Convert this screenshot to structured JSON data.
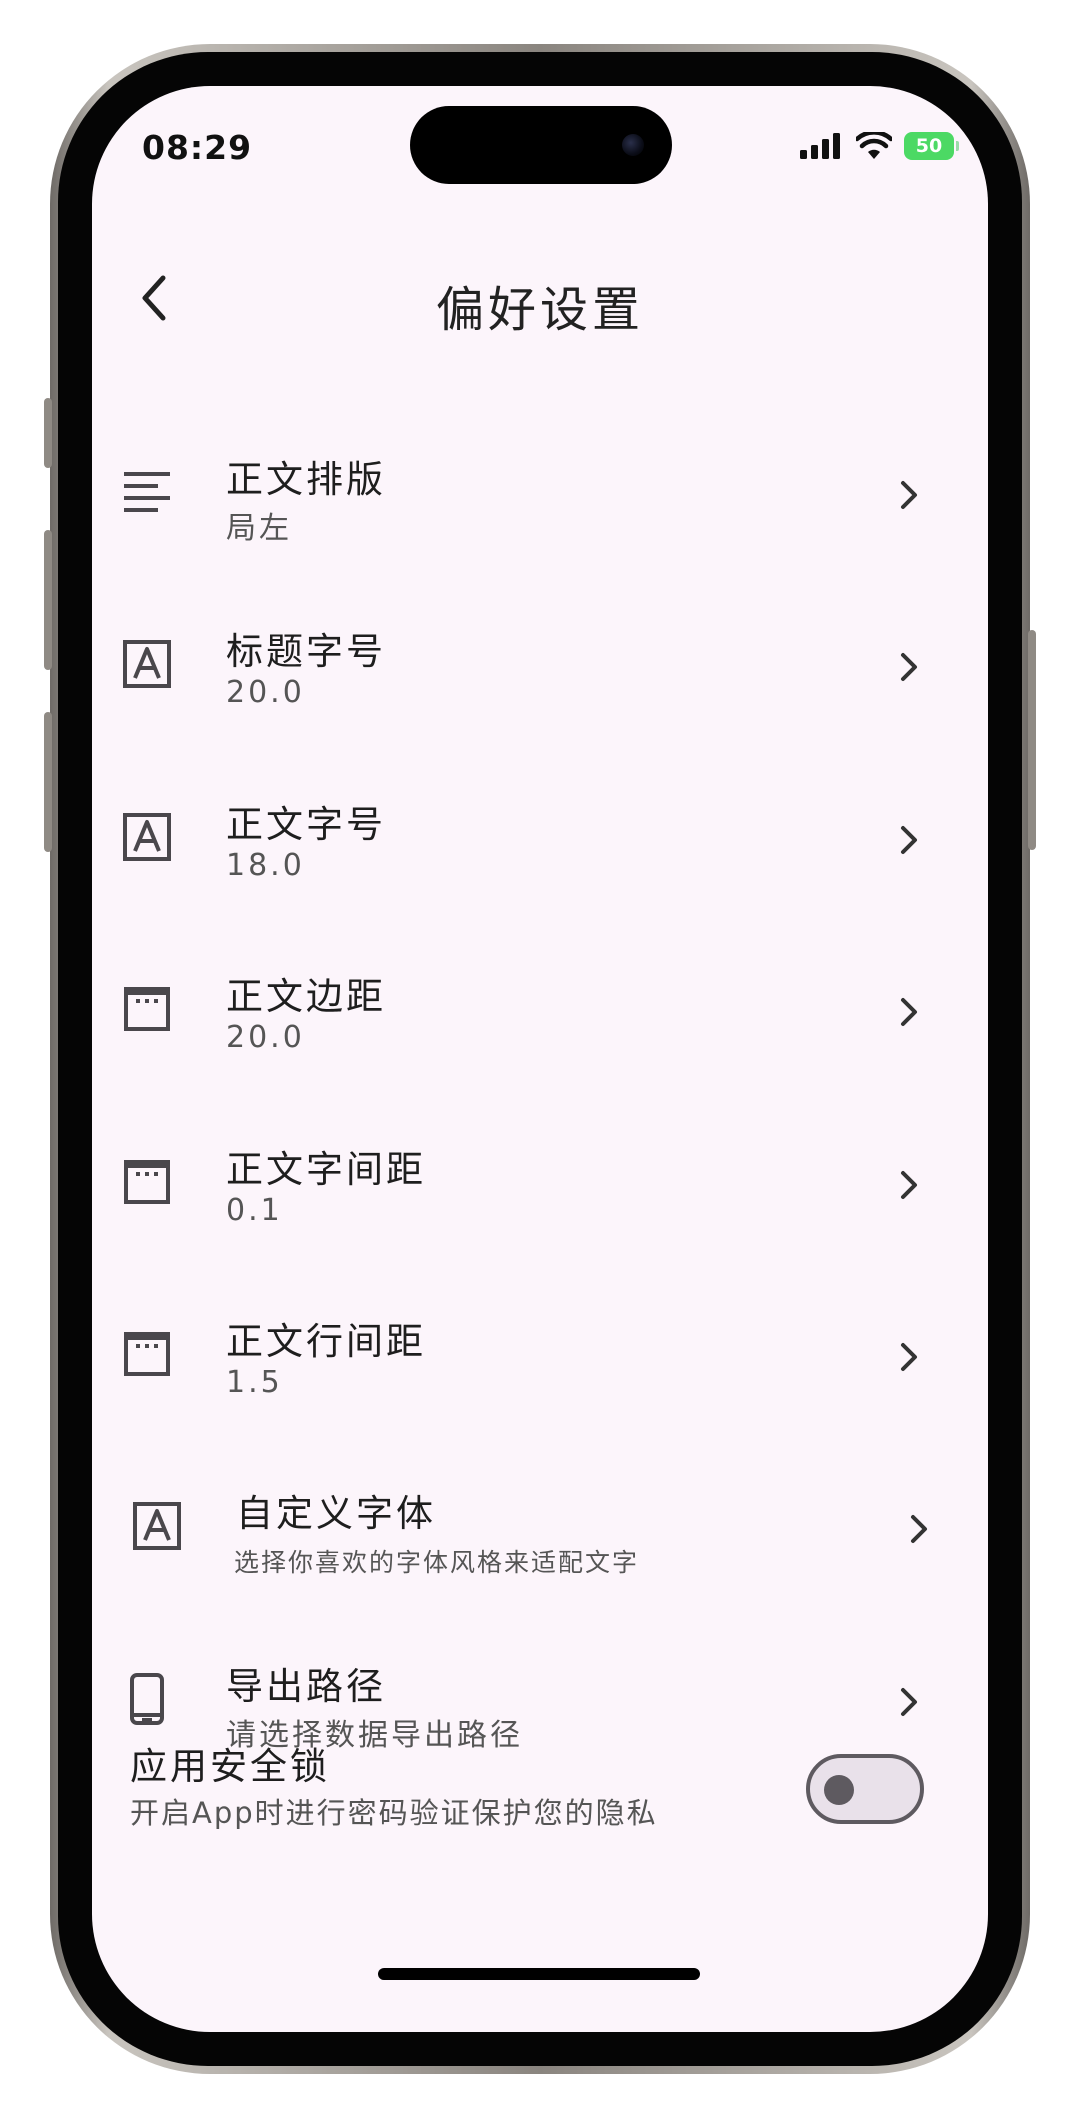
{
  "status_bar": {
    "time": "08:29",
    "battery": "50"
  },
  "header": {
    "title": "偏好设置",
    "back_icon": "chevron-left-icon"
  },
  "settings": [
    {
      "title": "正文排版",
      "subtitle": "局左",
      "icon": "align-left-icon"
    },
    {
      "title": "标题字号",
      "subtitle": "20.0",
      "icon": "font-size-icon"
    },
    {
      "title": "正文字号",
      "subtitle": "18.0",
      "icon": "font-size-icon"
    },
    {
      "title": "正文边距",
      "subtitle": "20.0",
      "icon": "margin-icon"
    },
    {
      "title": "正文字间距",
      "subtitle": "0.1",
      "icon": "margin-icon"
    },
    {
      "title": "正文行间距",
      "subtitle": "1.5",
      "icon": "margin-icon"
    },
    {
      "title": "自定义字体",
      "subtitle": "选择你喜欢的字体风格来适配文字",
      "icon": "font-size-icon"
    },
    {
      "title": "导出路径",
      "subtitle": "请选择数据导出路径",
      "icon": "phone-icon"
    }
  ],
  "security_lock": {
    "title": "应用安全锁",
    "subtitle": "开启App时进行密码验证保护您的隐私",
    "enabled": false
  },
  "colors": {
    "background": "#fcf5fb",
    "text": "#1e1e1e",
    "subtext": "#555555",
    "icon": "#4a474c",
    "battery": "#4cd964"
  }
}
